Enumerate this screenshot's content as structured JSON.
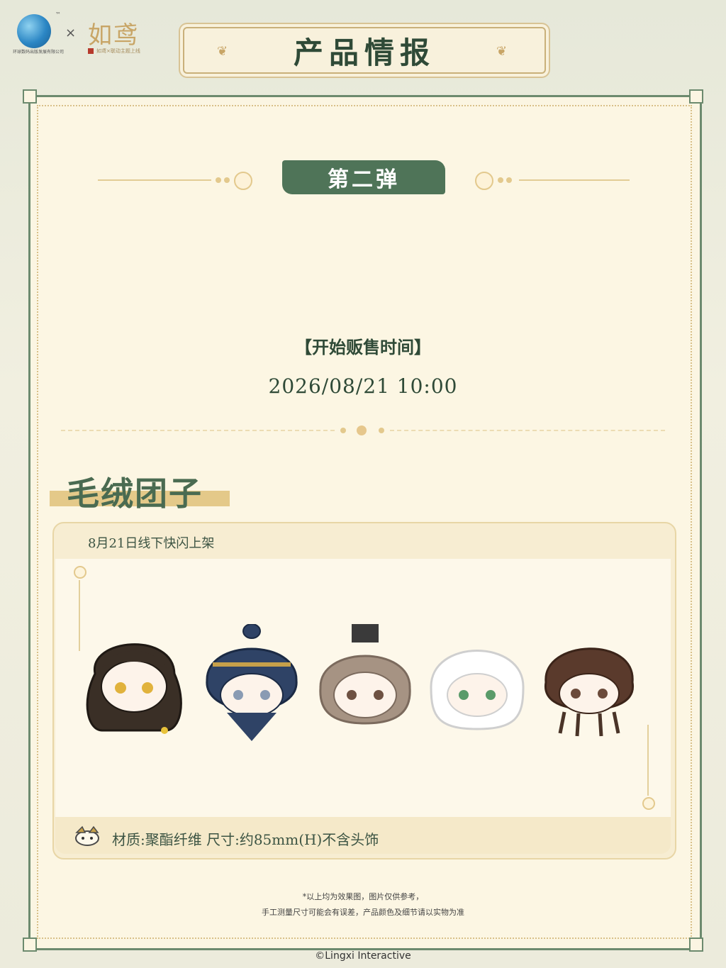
{
  "header": {
    "tm": "™",
    "times": "×",
    "brand": "如鸢",
    "company": "环球数码出版发展有限公司",
    "brand_sub": "如鸢×联动主题上线",
    "title": "产品情报"
  },
  "section": {
    "tag": "第二弹",
    "sale_heading": "【开始贩售时间】",
    "sale_time": "2026/08/21  10:00"
  },
  "product": {
    "title": "毛绒团子",
    "release_note": "8月21日线下快闪上架",
    "material": "材质:聚酯纤维   尺寸:约85mm(H)不含头饰",
    "plushies": [
      {
        "hair": "#3a2f26",
        "hair_dark": "#1f1914",
        "eyes": "#e1b23c",
        "accent": "#e8c23a"
      },
      {
        "hair": "#2f4366",
        "hair_dark": "#1b2a44",
        "eyes": "#8a9bb3",
        "accent": "#c6a04a"
      },
      {
        "hair": "#a69383",
        "hair_dark": "#7b6a5d",
        "eyes": "#6e5142",
        "accent": "#3a3a3a"
      },
      {
        "hair": "#ffffff",
        "hair_dark": "#cfcfcf",
        "eyes": "#5a9b6a",
        "accent": "#e9e9e9"
      },
      {
        "hair": "#5a3a2c",
        "hair_dark": "#3b2419",
        "eyes": "#6b4a3a",
        "accent": "#4a3428"
      }
    ]
  },
  "footer": {
    "disclaimer1": "*以上均为效果图，图片仅供参考，",
    "disclaimer2": "手工测量尺寸可能会有误差，产品颜色及细节请以实物为准",
    "copyright": "©Lingxi Interactive"
  },
  "colors": {
    "primary_green": "#2f4a37",
    "accent_gold": "#e4c989",
    "card_bg": "#fbf5e2"
  }
}
